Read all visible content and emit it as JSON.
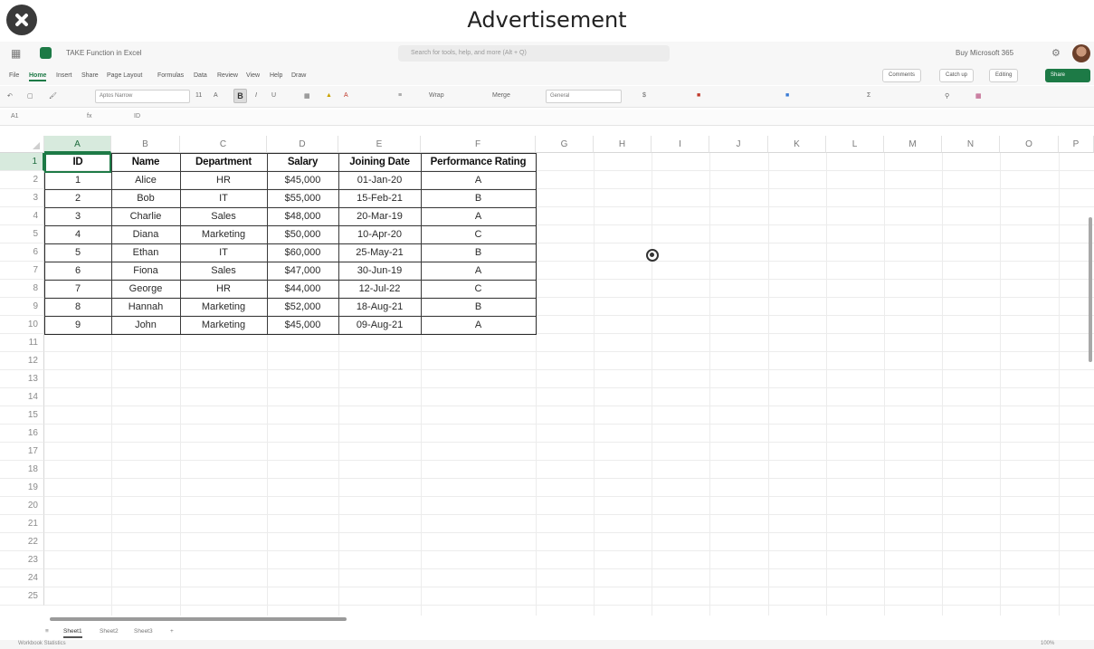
{
  "ad": {
    "label": "Advertisement"
  },
  "titlebar": {
    "doc_name": "TAKE Function in Excel",
    "search_placeholder": "Search for tools, help, and more (Alt + Q)",
    "buy_label": "Buy Microsoft 365"
  },
  "menu": {
    "items": [
      "File",
      "Home",
      "Insert",
      "Share",
      "Page Layout",
      "Formulas",
      "Data",
      "Review",
      "View",
      "Help",
      "Draw"
    ],
    "active": "Home",
    "comments_label": "Comments",
    "catchup_label": "Catch up",
    "editing_label": "Editing",
    "share_label": "Share"
  },
  "ribbon": {
    "font_name": "Aptos Narrow",
    "font_size": "11",
    "bold_label": "B",
    "italic_label": "I",
    "wrap_label": "Wrap",
    "merge_label": "Merge",
    "number_format": "General"
  },
  "formula_bar": {
    "name_box": "A1",
    "fx": "fx",
    "value": "ID"
  },
  "columns": [
    "A",
    "B",
    "C",
    "D",
    "E",
    "F",
    "G",
    "H",
    "I",
    "J",
    "K",
    "L",
    "M",
    "N",
    "O",
    "P"
  ],
  "rows": [
    "1",
    "2",
    "3",
    "4",
    "5",
    "6",
    "7",
    "8",
    "9",
    "10",
    "11",
    "12",
    "13",
    "14",
    "15",
    "16",
    "17",
    "18",
    "19",
    "20",
    "21",
    "22",
    "23",
    "24",
    "25"
  ],
  "table": {
    "headers": [
      "ID",
      "Name",
      "Department",
      "Salary",
      "Joining Date",
      "Performance Rating"
    ],
    "rows": [
      [
        "1",
        "Alice",
        "HR",
        "$45,000",
        "01-Jan-20",
        "A"
      ],
      [
        "2",
        "Bob",
        "IT",
        "$55,000",
        "15-Feb-21",
        "B"
      ],
      [
        "3",
        "Charlie",
        "Sales",
        "$48,000",
        "20-Mar-19",
        "A"
      ],
      [
        "4",
        "Diana",
        "Marketing",
        "$50,000",
        "10-Apr-20",
        "C"
      ],
      [
        "5",
        "Ethan",
        "IT",
        "$60,000",
        "25-May-21",
        "B"
      ],
      [
        "6",
        "Fiona",
        "Sales",
        "$47,000",
        "30-Jun-19",
        "A"
      ],
      [
        "7",
        "George",
        "HR",
        "$44,000",
        "12-Jul-22",
        "C"
      ],
      [
        "8",
        "Hannah",
        "Marketing",
        "$52,000",
        "18-Aug-21",
        "B"
      ],
      [
        "9",
        "John",
        "Marketing",
        "$45,000",
        "09-Aug-21",
        "A"
      ]
    ]
  },
  "sheets": {
    "tabs": [
      "Sheet1",
      "Sheet2",
      "Sheet3"
    ],
    "active": "Sheet1",
    "add_label": "+"
  },
  "status": {
    "left": "Workbook Statistics",
    "zoom": "100%"
  },
  "colors": {
    "accent": "#1d7a46",
    "selection": "#d7eadd"
  }
}
